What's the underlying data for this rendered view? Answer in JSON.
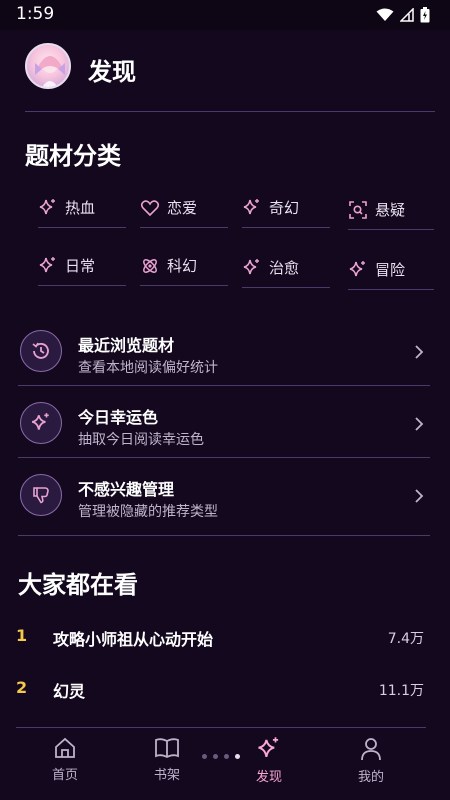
{
  "status": {
    "time": "1:59"
  },
  "header": {
    "title": "发现"
  },
  "genres": {
    "title": "题材分类",
    "items": [
      {
        "label": "热血",
        "icon": "sparkle-icon"
      },
      {
        "label": "恋爱",
        "icon": "heart-icon"
      },
      {
        "label": "奇幻",
        "icon": "sparkle-icon"
      },
      {
        "label": "悬疑",
        "icon": "search-frame-icon"
      },
      {
        "label": "日常",
        "icon": "sparkle-icon"
      },
      {
        "label": "科幻",
        "icon": "atom-icon"
      },
      {
        "label": "治愈",
        "icon": "sparkle-icon"
      },
      {
        "label": "冒险",
        "icon": "sparkle-icon"
      }
    ]
  },
  "cards": [
    {
      "title": "最近浏览题材",
      "subtitle": "查看本地阅读偏好统计",
      "icon": "history-icon"
    },
    {
      "title": "今日幸运色",
      "subtitle": "抽取今日阅读幸运色",
      "icon": "sparkle-icon"
    },
    {
      "title": "不感兴趣管理",
      "subtitle": "管理被隐藏的推荐类型",
      "icon": "thumbs-down-icon"
    }
  ],
  "trending": {
    "title": "大家都在看",
    "items": [
      {
        "rank": "1",
        "title": "攻略小师祖从心动开始",
        "count": "7.4万"
      },
      {
        "rank": "2",
        "title": "幻灵",
        "count": "11.1万"
      }
    ]
  },
  "tabs": [
    {
      "label": "首页",
      "icon": "home-icon"
    },
    {
      "label": "书架",
      "icon": "book-icon"
    },
    {
      "label": "发现",
      "icon": "sparkle-icon",
      "active": true
    },
    {
      "label": "我的",
      "icon": "user-icon"
    }
  ],
  "colors": {
    "accent": "#f8a7d2",
    "background": "#13081d",
    "rank": "#f2c94c"
  }
}
